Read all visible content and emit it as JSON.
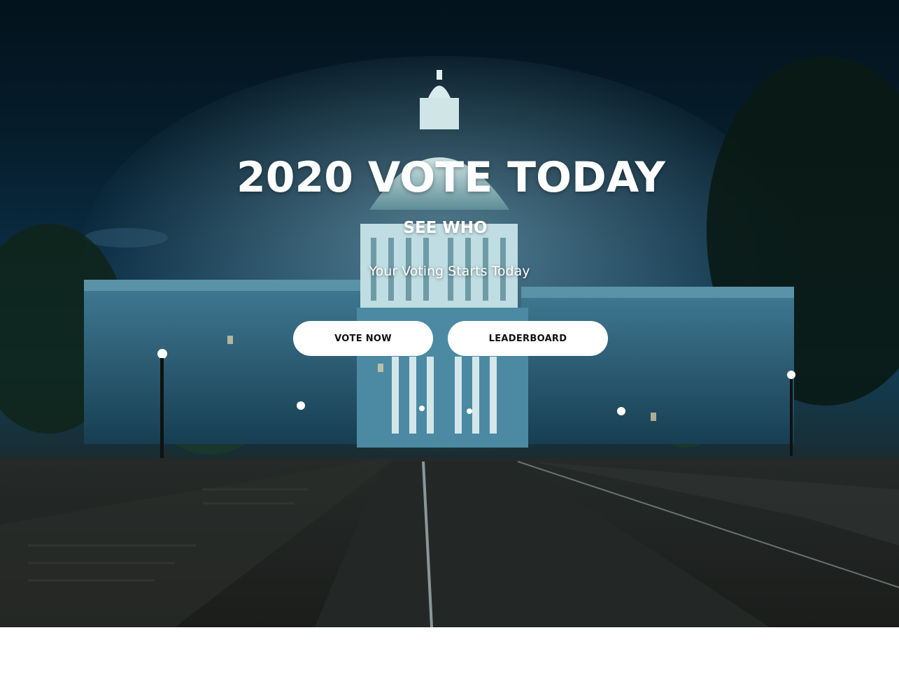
{
  "hero": {
    "headline": "2020 VOTE TODAY",
    "subheadline": "SEE WHO",
    "tagline": "Your Voting Starts Today",
    "background_image": "capitol-building-night-photo"
  },
  "actions": {
    "vote_now_label": "VOTE NOW",
    "leaderboard_label": "LEADERBOARD"
  },
  "colors": {
    "button_bg": "#ffffff",
    "button_text": "#111111",
    "heading_text": "#ffffff",
    "night_sky": "#061d2c"
  }
}
